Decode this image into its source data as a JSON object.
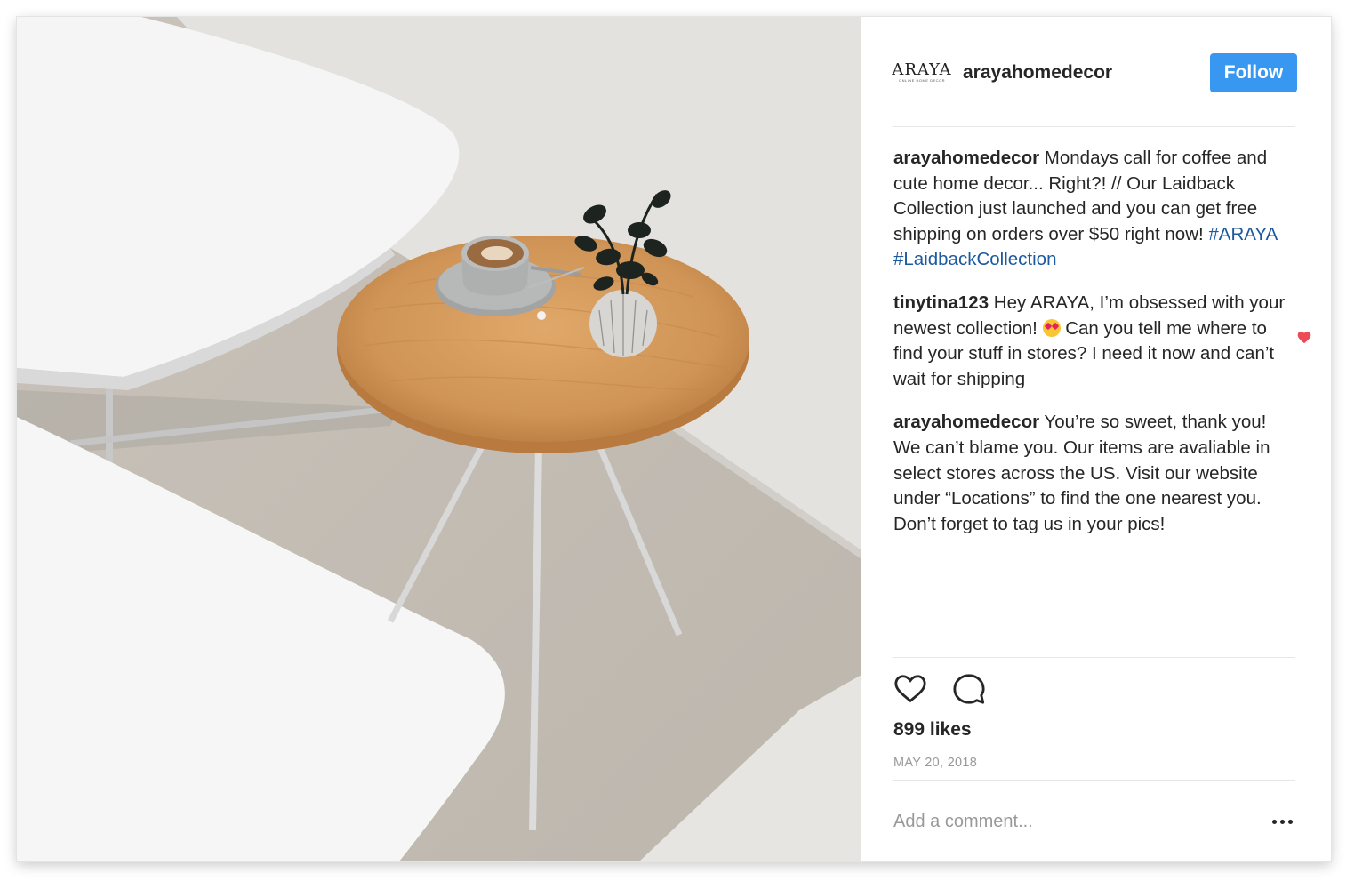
{
  "post": {
    "brand_logo_text": "ARAYA",
    "brand_logo_subtext": "ONLINE HOME DECOR",
    "username": "arayahomedecor",
    "follow_label": "Follow",
    "caption": {
      "author": "arayahomedecor",
      "text": " Mondays call for coffee and cute home decor... Right?! // Our Laidback Collection just launched and you can get free shipping on orders over $50 right now! ",
      "hashtags": [
        "#ARAYA",
        "#LaidbackCollection"
      ]
    },
    "comments": [
      {
        "author": "tinytina123",
        "text_before_emoji": " Hey ARAYA, I’m obsessed with your newest collection! ",
        "emoji": "heart-eyes-emoji",
        "text_after_emoji": " Can you tell me where to find your stuff in stores? I need it now and can’t wait for shipping",
        "liked": true
      },
      {
        "author": "arayahomedecor",
        "text": " You’re so sweet, thank you! We can’t blame you. Our items are avaliable in select stores across the US. Visit our website under “Locations” to find the one nearest you. Don’t forget to tag us in your pics!"
      }
    ],
    "likes_label": "899 likes",
    "date": "MAY 20, 2018",
    "comment_placeholder": "Add a comment...",
    "icons": [
      "heart-icon",
      "comment-icon",
      "more-options-icon",
      "like-comment-heart-icon"
    ]
  },
  "colors": {
    "follow_button": "#3897f0",
    "hashtag": "#1c5aa0",
    "liked_heart": "#ed4956",
    "text": "#262626",
    "muted": "#999999"
  }
}
